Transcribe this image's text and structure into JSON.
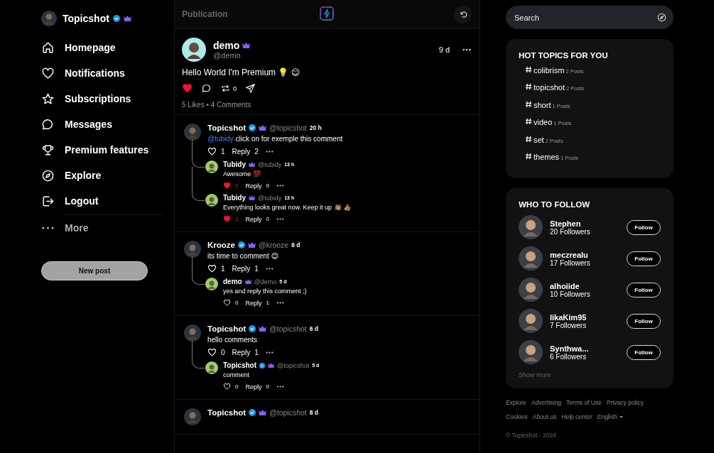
{
  "sidebar": {
    "profile": {
      "name": "Topicshot",
      "verified": true,
      "premium": true
    },
    "nav": [
      {
        "label": "Homepage"
      },
      {
        "label": "Notifications"
      },
      {
        "label": "Subscriptions"
      },
      {
        "label": "Messages"
      },
      {
        "label": "Premium features"
      },
      {
        "label": "Explore"
      },
      {
        "label": "Logout"
      }
    ],
    "more": "More",
    "new_post": "New post"
  },
  "feed": {
    "title": "Publication",
    "post": {
      "author": "demo",
      "handle": "@demo",
      "premium": true,
      "time": "9 d",
      "text": "Hello World I'm Premium 💡 😊",
      "liked": true,
      "reposts": "0",
      "stats": "5 Likes • 4 Comments"
    },
    "comments": [
      {
        "author": "Topicshot",
        "verified": true,
        "premium": true,
        "handle": "@topicshot",
        "time": "20 h",
        "mention": "@tubidy",
        "text": "click on for exemple this comment",
        "liked": false,
        "likes": "1",
        "reply_label": "Reply",
        "reply_count": "2",
        "replies": [
          {
            "author": "Tubidy",
            "verified": false,
            "premium": true,
            "handle": "@tubidy",
            "time": "13 h",
            "text": "Awesome 💯",
            "liked": true,
            "likes": "2",
            "reply_label": "Reply",
            "reply_count": "0"
          },
          {
            "author": "Tubidy",
            "verified": false,
            "premium": true,
            "handle": "@tubidy",
            "time": "13 h",
            "text": "Everything looks great now. Keep it up 👏🏽 👍🏽",
            "liked": true,
            "likes": "2",
            "reply_label": "Reply",
            "reply_count": "0"
          }
        ]
      },
      {
        "author": "Krooze",
        "verified": true,
        "premium": true,
        "handle": "@krooze",
        "time": "6 d",
        "text": "its time to comment 😊",
        "liked": false,
        "likes": "1",
        "reply_label": "Reply",
        "reply_count": "1",
        "replies": [
          {
            "author": "demo",
            "verified": false,
            "premium": true,
            "handle": "@demo",
            "time": "5 d",
            "text": "yes and reply this comment ;)",
            "liked": false,
            "likes": "0",
            "reply_label": "Reply",
            "reply_count": "1"
          }
        ]
      },
      {
        "author": "Topicshot",
        "verified": true,
        "premium": true,
        "handle": "@topicshot",
        "time": "6 d",
        "text": "hello comments",
        "liked": false,
        "likes": "0",
        "reply_label": "Reply",
        "reply_count": "1",
        "replies": [
          {
            "author": "Topicshot",
            "verified": true,
            "premium": true,
            "handle": "@topicshot",
            "time": "5 d",
            "text": "comment",
            "liked": false,
            "likes": "0",
            "reply_label": "Reply",
            "reply_count": "0"
          }
        ]
      },
      {
        "author": "Topicshot",
        "verified": true,
        "premium": true,
        "handle": "@topicshot",
        "time": "8 d"
      }
    ]
  },
  "aside": {
    "search": {
      "placeholder": "Search"
    },
    "hot_topics": {
      "title": "HOT TOPICS FOR YOU",
      "topics": [
        {
          "tag": "colibrism",
          "count": "2 Posts"
        },
        {
          "tag": "topicshot",
          "count": "2 Posts"
        },
        {
          "tag": "short",
          "count": "1 Posts"
        },
        {
          "tag": "video",
          "count": "1 Posts"
        },
        {
          "tag": "set",
          "count": "2 Posts"
        },
        {
          "tag": "themes",
          "count": "1 Posts"
        }
      ]
    },
    "who_to_follow": {
      "title": "WHO TO FOLLOW",
      "users": [
        {
          "name": "Stephen",
          "followers": "20 Followers",
          "button": "Follow"
        },
        {
          "name": "meczrealu",
          "followers": "17 Followers",
          "button": "Follow"
        },
        {
          "name": "alhoiide",
          "followers": "10 Followers",
          "button": "Follow"
        },
        {
          "name": "likaKim95",
          "followers": "7 Followers",
          "button": "Follow"
        },
        {
          "name": "Synthwa...",
          "followers": "6 Followers",
          "button": "Follow"
        }
      ],
      "show_more": "Show more"
    },
    "footer": {
      "links": [
        [
          "Explore",
          "Advertising",
          "Terms of Use",
          "Privacy policy"
        ],
        [
          "Cookies",
          "About us",
          "Help center"
        ]
      ],
      "language": "English",
      "copyright": "© Topicshot - 2024"
    }
  }
}
